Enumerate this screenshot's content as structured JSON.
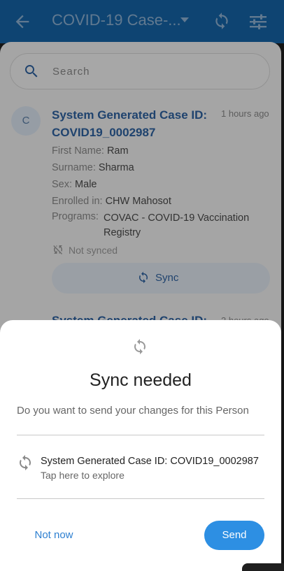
{
  "appbar": {
    "title": "COVID-19 Case-...",
    "back_icon": "arrow-back-icon",
    "sync_icon": "sync-icon",
    "filter_icon": "filter-icon",
    "bg_color": "#1565a8"
  },
  "search": {
    "placeholder": "Search"
  },
  "case1": {
    "avatar": "C",
    "title": "System Generated Case ID: COVID19_0002987",
    "time": "1 hours ago",
    "first_name_label": "First Name:",
    "first_name": "Ram",
    "surname_label": "Surname:",
    "surname": "Sharma",
    "sex_label": "Sex:",
    "sex": "Male",
    "enrolled_label": "Enrolled in:",
    "enrolled": "CHW Mahosot",
    "programs_label": "Programs:",
    "programs": "COVAC - COVID-19 Vaccination Registry",
    "status": "Not synced",
    "sync_label": "Sync"
  },
  "case2": {
    "title": "System Generated Case ID:",
    "time": "2 hours ago"
  },
  "dialog": {
    "title": "Sync needed",
    "description": "Do you want to send your changes for this Person",
    "item_title": "System Generated Case ID: COVID19_0002987",
    "item_subtitle": "Tap here to explore",
    "dismiss_label": "Not now",
    "confirm_label": "Send",
    "accent_color": "#2d8fe3"
  }
}
